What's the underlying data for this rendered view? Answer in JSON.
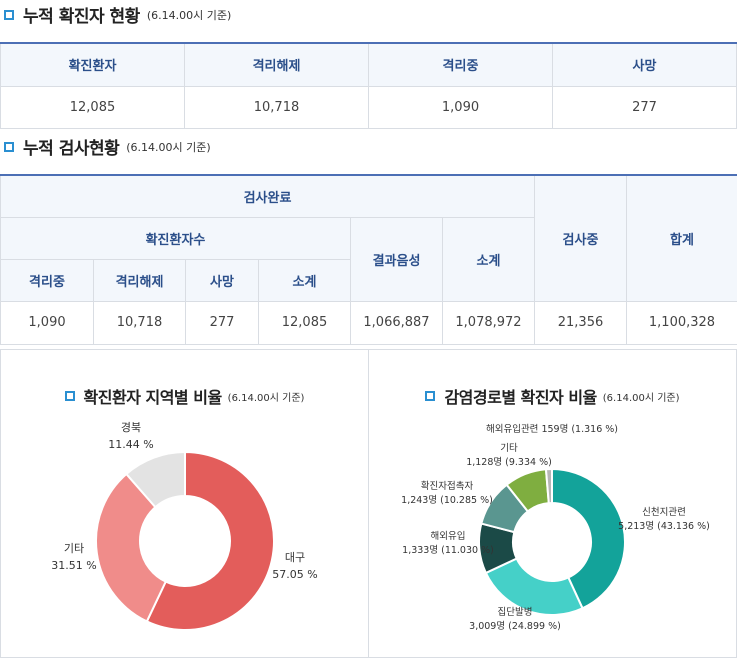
{
  "section1": {
    "title": "누적 확진자 현황",
    "subtitle": "(6.14.00시 기준)"
  },
  "table1": {
    "headers": [
      "확진환자",
      "격리해제",
      "격리중",
      "사망"
    ],
    "values": [
      "12,085",
      "10,718",
      "1,090",
      "277"
    ]
  },
  "section2": {
    "title": "누적 검사현황",
    "subtitle": "(6.14.00시 기준)"
  },
  "table2": {
    "h_done": "검사완료",
    "h_confirmed": "확진환자수",
    "h_negative": "결과음성",
    "h_subtotal": "소계",
    "h_testing": "검사중",
    "h_total": "합계",
    "h_isolating": "격리중",
    "h_released": "격리해제",
    "h_death": "사망",
    "h_sub_confirmed": "소계",
    "values": [
      "1,090",
      "10,718",
      "277",
      "12,085",
      "1,066,887",
      "1,078,972",
      "21,356",
      "1,100,328"
    ]
  },
  "panel_left": {
    "title": "확진환자 지역별 비율",
    "subtitle": "(6.14.00시 기준)"
  },
  "panel_right": {
    "title": "감염경로별 확진자 비율",
    "subtitle": "(6.14.00시 기준)"
  },
  "chart_data": [
    {
      "type": "pie",
      "title": "확진환자 지역별 비율",
      "slices": [
        {
          "label": "대구",
          "value": 57.05,
          "text": "57.05 %",
          "color": "#e35d5b"
        },
        {
          "label": "기타",
          "value": 31.51,
          "text": "31.51 %",
          "color": "#f08c8a"
        },
        {
          "label": "경북",
          "value": 11.44,
          "text": "11.44 %",
          "color": "#e3e3e3"
        }
      ]
    },
    {
      "type": "pie",
      "title": "감염경로별 확진자 비율",
      "slices": [
        {
          "label": "신천지관련",
          "value": 43.136,
          "text": "5,213명 (43.136 %)",
          "color": "#13a39a"
        },
        {
          "label": "집단발병",
          "value": 24.899,
          "text": "3,009명 (24.899 %)",
          "color": "#45d0c8"
        },
        {
          "label": "해외유입",
          "value": 11.03,
          "text": "1,333명 (11.030 %)",
          "color": "#1b4a47"
        },
        {
          "label": "확진자접촉자",
          "value": 10.285,
          "text": "1,243명 (10.285 %)",
          "color": "#5a9690"
        },
        {
          "label": "기타",
          "value": 9.334,
          "text": "1,128명 (9.334 %)",
          "color": "#7fae40"
        },
        {
          "label": "해외유입관련",
          "value": 1.316,
          "text": "159명 (1.316 %)",
          "color": "#b6b6b6"
        }
      ]
    }
  ]
}
